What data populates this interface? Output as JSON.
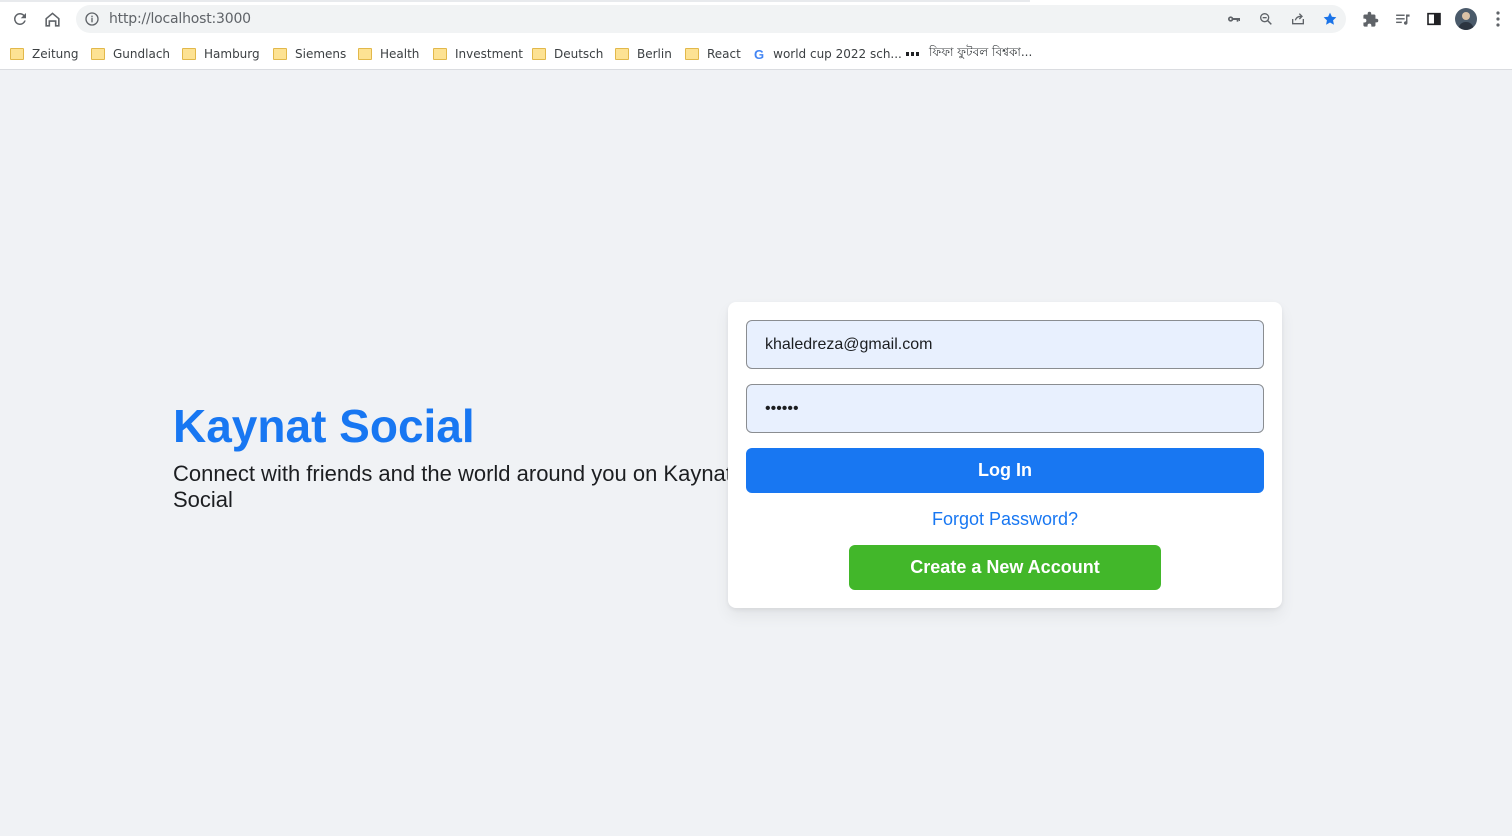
{
  "browser": {
    "url": "http://localhost:3000",
    "bookmarks": [
      {
        "label": "Zeitung",
        "type": "folder"
      },
      {
        "label": "Gundlach",
        "type": "folder"
      },
      {
        "label": "Hamburg",
        "type": "folder"
      },
      {
        "label": "Siemens",
        "type": "folder"
      },
      {
        "label": "Health",
        "type": "folder"
      },
      {
        "label": "Investment",
        "type": "folder"
      },
      {
        "label": "Deutsch",
        "type": "folder"
      },
      {
        "label": "Berlin",
        "type": "folder"
      },
      {
        "label": "React",
        "type": "folder"
      },
      {
        "label": "world cup 2022 sch...",
        "type": "google"
      },
      {
        "label": "ফিফা ফুটবল বিশ্বকা...",
        "type": "site"
      }
    ],
    "bookmarked": true
  },
  "hero": {
    "title": "Kaynat Social",
    "tagline": "Connect with friends and the world around you on Kaynat Social"
  },
  "login": {
    "email_value": "khaledreza@gmail.com",
    "password_value": "••••••",
    "login_label": "Log In",
    "forgot_label": "Forgot Password?",
    "create_label": "Create a New Account"
  },
  "colors": {
    "brand": "#1877f2",
    "create": "#42b72a",
    "background": "#f0f2f5"
  }
}
